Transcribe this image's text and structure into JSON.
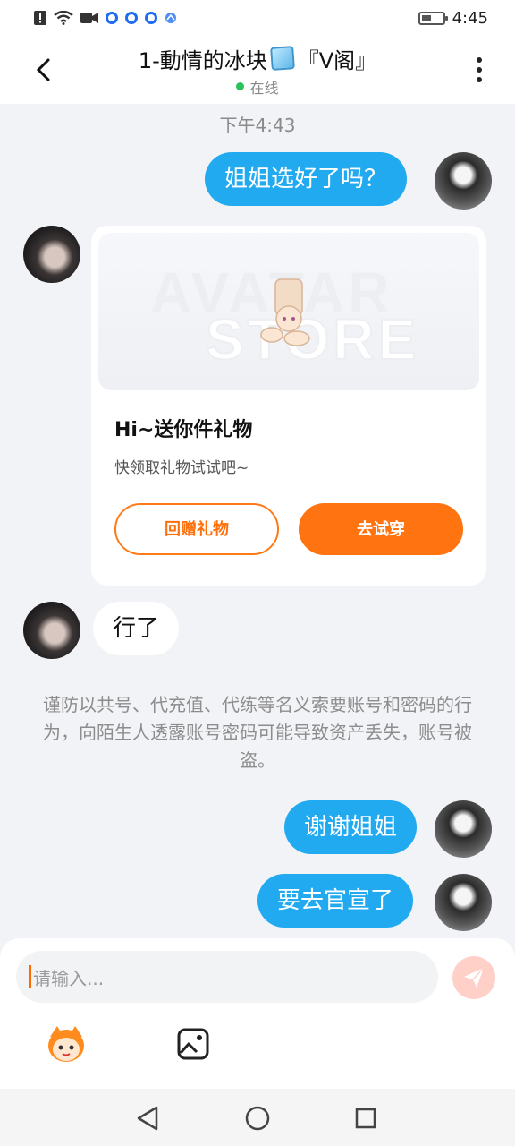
{
  "status_bar": {
    "time": "4:45",
    "icons": [
      "alert-icon",
      "wifi-icon",
      "video-icon",
      "app-icon",
      "app-icon",
      "app-icon",
      "app-icon",
      "battery-icon"
    ]
  },
  "header": {
    "title": "1-動情的冰块",
    "title_suffix": "『V阁』",
    "status": "在线"
  },
  "chat": {
    "timestamp": "下午4:43",
    "messages": [
      {
        "text": "姐姐选好了吗？"
      },
      {
        "text": "行了"
      },
      {
        "text": "谢谢姐姐"
      },
      {
        "text": "要去官宣了"
      }
    ],
    "gift_card": {
      "banner_text_1": "AVATAR",
      "banner_text_2": "STORE",
      "title": "Hi~送你件礼物",
      "subtitle": "快领取礼物试试吧~",
      "button_return": "回赠礼物",
      "button_try": "去试穿"
    },
    "notice": "谨防以共号、代充值、代练等名义索要账号和密码的行为，向陌生人透露账号密码可能导致资产丢失，账号被盗。"
  },
  "composer": {
    "placeholder": "请输入...",
    "accent_color": "#ff7410"
  },
  "colors": {
    "outgoing_bubble": "#22aaf1",
    "online": "#2bc25a"
  }
}
